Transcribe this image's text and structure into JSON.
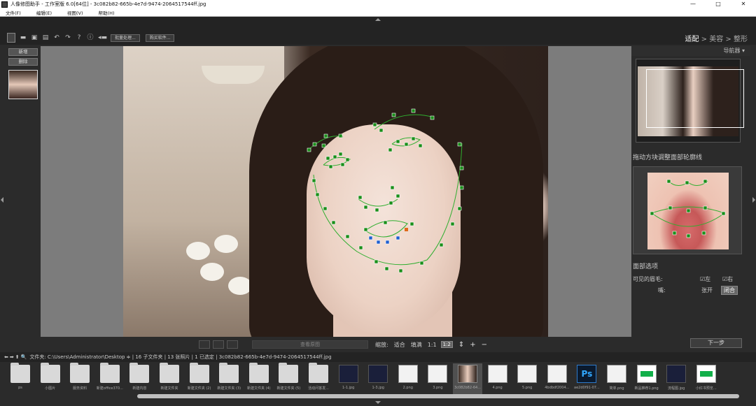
{
  "window": {
    "title": "人像修图助手 - 工作室版 6.0[64位] - 3c082b82-665b-4e7d-9474-2064517544ff.jpg",
    "controls": [
      "—",
      "□",
      "✕"
    ]
  },
  "menu": [
    "文件(F)",
    "编辑(E)",
    "视图(V)",
    "帮助(H)"
  ],
  "toolbar": {
    "batch_label": "批量处理...",
    "plugin_label": "购买软件..."
  },
  "steps": {
    "s1": "适配",
    "sep1": " > ",
    "s2": "美容",
    "sep2": " > ",
    "s3": "整形"
  },
  "left_panel": {
    "new_label": "新增",
    "delete_label": "删除"
  },
  "canvas_bar": {
    "view_original": "查看原图",
    "zoom_label": "缩放:",
    "fit": "适合",
    "fill": "填满",
    "one_to_one": "1:1",
    "one_to_two": "1:2",
    "plus": "+",
    "minus": "−"
  },
  "right_panel": {
    "navigator": "导航器 ▾",
    "hint": "拖动方块调整面部轮廓线",
    "face_options": "面部选项",
    "visible_brow": "可见的眉毛:",
    "left": "左",
    "right": "右",
    "mouth": "嘴:",
    "open": "张开",
    "closed": "闭合",
    "next": "下一步"
  },
  "path_bar": "文件夹: C:\\Users\\Administrator\\Desktop ≑ | 16 子文件夹 | 13 张照片 | 1 已选定 | 3c082b82-665b-4e7d-9474-2064517544ff.jpg",
  "files": [
    {
      "name": "ps",
      "kind": "folder"
    },
    {
      "name": "小图片",
      "kind": "folder"
    },
    {
      "name": "服务资料",
      "kind": "folder"
    },
    {
      "name": "新建office370...",
      "kind": "folder"
    },
    {
      "name": "新建内容",
      "kind": "folder"
    },
    {
      "name": "新建文件夹",
      "kind": "folder"
    },
    {
      "name": "新建文件夹 (2)",
      "kind": "folder"
    },
    {
      "name": "新建文件夹 (3)",
      "kind": "folder"
    },
    {
      "name": "新建文件夹 (4)",
      "kind": "folder"
    },
    {
      "name": "新建文件夹 (5)",
      "kind": "folder"
    },
    {
      "name": "活动问答发...",
      "kind": "folder"
    },
    {
      "name": "1-1.jpg",
      "kind": "img-dark"
    },
    {
      "name": "1-3.jpg",
      "kind": "img-dark"
    },
    {
      "name": "2.png",
      "kind": "img-light"
    },
    {
      "name": "3.png",
      "kind": "img-light"
    },
    {
      "name": "3c082b82-64...",
      "kind": "img-photo",
      "selected": true
    },
    {
      "name": "4.png",
      "kind": "img-light"
    },
    {
      "name": "5.png",
      "kind": "img-light"
    },
    {
      "name": "4bdbdf2004...",
      "kind": "img-light"
    },
    {
      "name": "ae2d0f91-07...",
      "kind": "img-ps"
    },
    {
      "name": "简单.png",
      "kind": "img-light"
    },
    {
      "name": "新品推荐1.png",
      "kind": "img-green"
    },
    {
      "name": "流程图.jpg",
      "kind": "img-dark"
    },
    {
      "name": "小红书预览...",
      "kind": "img-green"
    }
  ]
}
